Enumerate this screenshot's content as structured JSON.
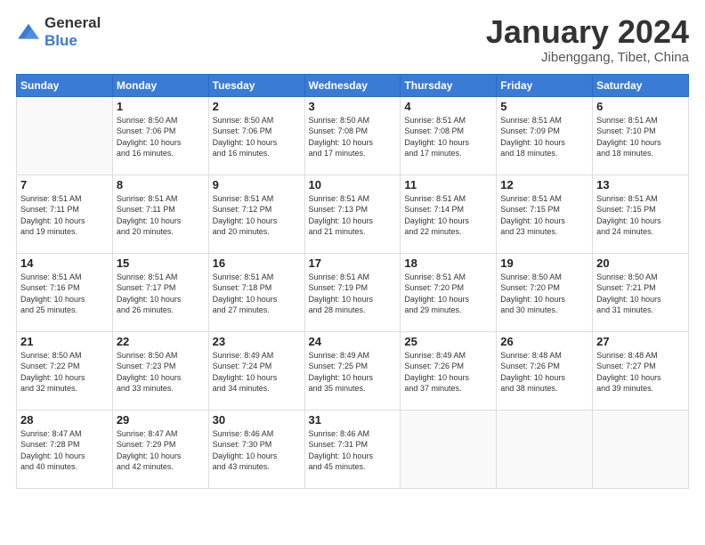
{
  "header": {
    "logo_general": "General",
    "logo_blue": "Blue",
    "month": "January 2024",
    "location": "Jibenggang, Tibet, China"
  },
  "weekdays": [
    "Sunday",
    "Monday",
    "Tuesday",
    "Wednesday",
    "Thursday",
    "Friday",
    "Saturday"
  ],
  "weeks": [
    [
      {
        "day": "",
        "info": ""
      },
      {
        "day": "1",
        "info": "Sunrise: 8:50 AM\nSunset: 7:06 PM\nDaylight: 10 hours\nand 16 minutes."
      },
      {
        "day": "2",
        "info": "Sunrise: 8:50 AM\nSunset: 7:06 PM\nDaylight: 10 hours\nand 16 minutes."
      },
      {
        "day": "3",
        "info": "Sunrise: 8:50 AM\nSunset: 7:08 PM\nDaylight: 10 hours\nand 17 minutes."
      },
      {
        "day": "4",
        "info": "Sunrise: 8:51 AM\nSunset: 7:08 PM\nDaylight: 10 hours\nand 17 minutes."
      },
      {
        "day": "5",
        "info": "Sunrise: 8:51 AM\nSunset: 7:09 PM\nDaylight: 10 hours\nand 18 minutes."
      },
      {
        "day": "6",
        "info": "Sunrise: 8:51 AM\nSunset: 7:10 PM\nDaylight: 10 hours\nand 18 minutes."
      }
    ],
    [
      {
        "day": "7",
        "info": "Sunrise: 8:51 AM\nSunset: 7:11 PM\nDaylight: 10 hours\nand 19 minutes."
      },
      {
        "day": "8",
        "info": "Sunrise: 8:51 AM\nSunset: 7:11 PM\nDaylight: 10 hours\nand 20 minutes."
      },
      {
        "day": "9",
        "info": "Sunrise: 8:51 AM\nSunset: 7:12 PM\nDaylight: 10 hours\nand 20 minutes."
      },
      {
        "day": "10",
        "info": "Sunrise: 8:51 AM\nSunset: 7:13 PM\nDaylight: 10 hours\nand 21 minutes."
      },
      {
        "day": "11",
        "info": "Sunrise: 8:51 AM\nSunset: 7:14 PM\nDaylight: 10 hours\nand 22 minutes."
      },
      {
        "day": "12",
        "info": "Sunrise: 8:51 AM\nSunset: 7:15 PM\nDaylight: 10 hours\nand 23 minutes."
      },
      {
        "day": "13",
        "info": "Sunrise: 8:51 AM\nSunset: 7:15 PM\nDaylight: 10 hours\nand 24 minutes."
      }
    ],
    [
      {
        "day": "14",
        "info": "Sunrise: 8:51 AM\nSunset: 7:16 PM\nDaylight: 10 hours\nand 25 minutes."
      },
      {
        "day": "15",
        "info": "Sunrise: 8:51 AM\nSunset: 7:17 PM\nDaylight: 10 hours\nand 26 minutes."
      },
      {
        "day": "16",
        "info": "Sunrise: 8:51 AM\nSunset: 7:18 PM\nDaylight: 10 hours\nand 27 minutes."
      },
      {
        "day": "17",
        "info": "Sunrise: 8:51 AM\nSunset: 7:19 PM\nDaylight: 10 hours\nand 28 minutes."
      },
      {
        "day": "18",
        "info": "Sunrise: 8:51 AM\nSunset: 7:20 PM\nDaylight: 10 hours\nand 29 minutes."
      },
      {
        "day": "19",
        "info": "Sunrise: 8:50 AM\nSunset: 7:20 PM\nDaylight: 10 hours\nand 30 minutes."
      },
      {
        "day": "20",
        "info": "Sunrise: 8:50 AM\nSunset: 7:21 PM\nDaylight: 10 hours\nand 31 minutes."
      }
    ],
    [
      {
        "day": "21",
        "info": "Sunrise: 8:50 AM\nSunset: 7:22 PM\nDaylight: 10 hours\nand 32 minutes."
      },
      {
        "day": "22",
        "info": "Sunrise: 8:50 AM\nSunset: 7:23 PM\nDaylight: 10 hours\nand 33 minutes."
      },
      {
        "day": "23",
        "info": "Sunrise: 8:49 AM\nSunset: 7:24 PM\nDaylight: 10 hours\nand 34 minutes."
      },
      {
        "day": "24",
        "info": "Sunrise: 8:49 AM\nSunset: 7:25 PM\nDaylight: 10 hours\nand 35 minutes."
      },
      {
        "day": "25",
        "info": "Sunrise: 8:49 AM\nSunset: 7:26 PM\nDaylight: 10 hours\nand 37 minutes."
      },
      {
        "day": "26",
        "info": "Sunrise: 8:48 AM\nSunset: 7:26 PM\nDaylight: 10 hours\nand 38 minutes."
      },
      {
        "day": "27",
        "info": "Sunrise: 8:48 AM\nSunset: 7:27 PM\nDaylight: 10 hours\nand 39 minutes."
      }
    ],
    [
      {
        "day": "28",
        "info": "Sunrise: 8:47 AM\nSunset: 7:28 PM\nDaylight: 10 hours\nand 40 minutes."
      },
      {
        "day": "29",
        "info": "Sunrise: 8:47 AM\nSunset: 7:29 PM\nDaylight: 10 hours\nand 42 minutes."
      },
      {
        "day": "30",
        "info": "Sunrise: 8:46 AM\nSunset: 7:30 PM\nDaylight: 10 hours\nand 43 minutes."
      },
      {
        "day": "31",
        "info": "Sunrise: 8:46 AM\nSunset: 7:31 PM\nDaylight: 10 hours\nand 45 minutes."
      },
      {
        "day": "",
        "info": ""
      },
      {
        "day": "",
        "info": ""
      },
      {
        "day": "",
        "info": ""
      }
    ]
  ]
}
